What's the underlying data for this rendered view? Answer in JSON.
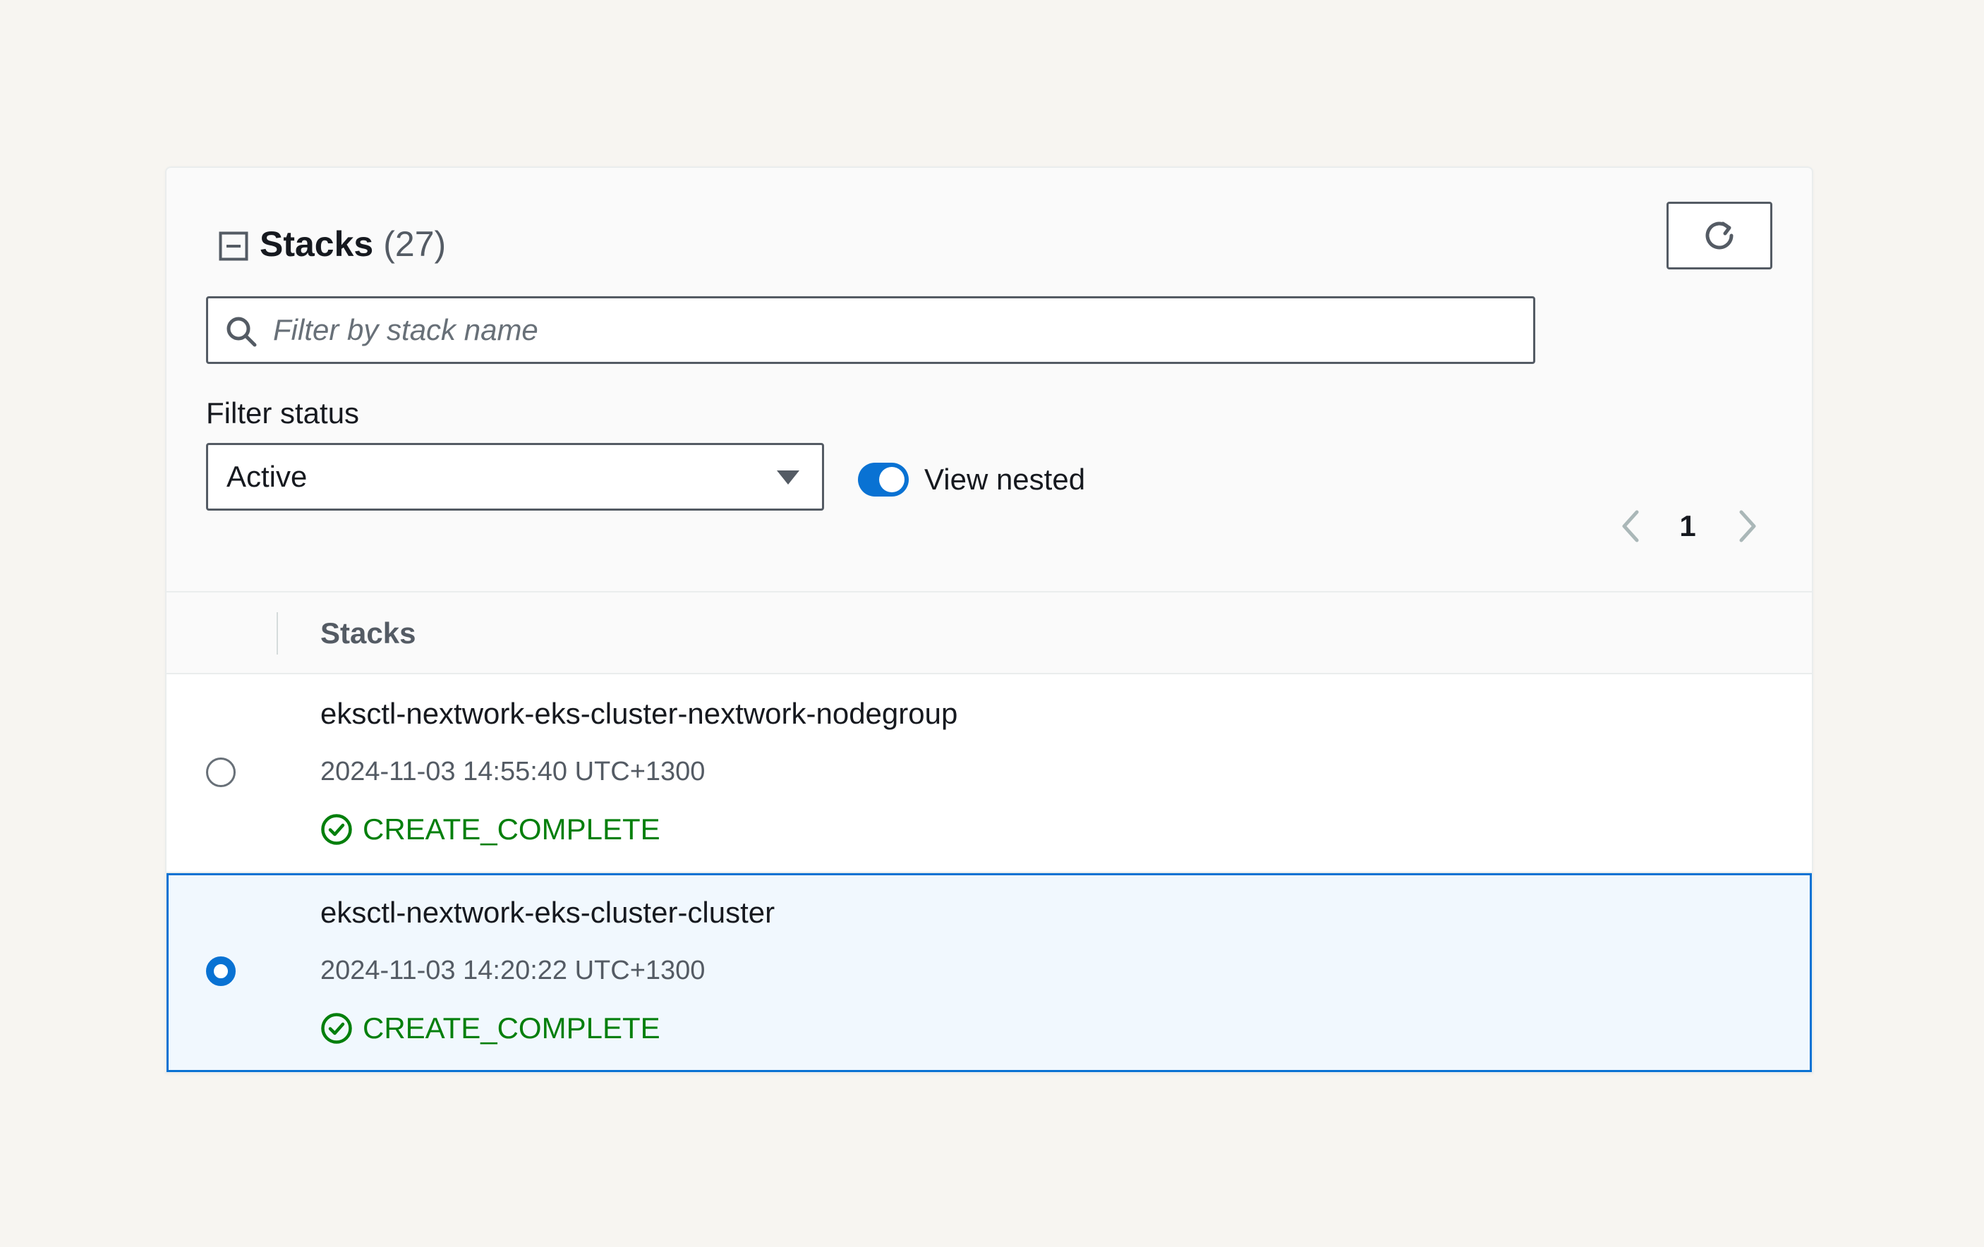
{
  "header": {
    "title": "Stacks",
    "count": "(27)"
  },
  "search": {
    "placeholder": "Filter by stack name",
    "value": ""
  },
  "filter_status": {
    "label": "Filter status",
    "selected": "Active"
  },
  "view_nested": {
    "label": "View nested",
    "enabled": true
  },
  "pagination": {
    "current_page": "1"
  },
  "table": {
    "column": "Stacks",
    "rows": [
      {
        "name": "eksctl-nextwork-eks-cluster-nextwork-nodegroup",
        "timestamp": "2024-11-03 14:55:40 UTC+1300",
        "status": "CREATE_COMPLETE",
        "selected": false
      },
      {
        "name": "eksctl-nextwork-eks-cluster-cluster",
        "timestamp": "2024-11-03 14:20:22 UTC+1300",
        "status": "CREATE_COMPLETE",
        "selected": true
      }
    ]
  },
  "colors": {
    "accent": "#0972d3",
    "success": "#037f0c",
    "selected_row_bg": "#f1f8fe",
    "page_bg": "#f7f5f1"
  },
  "icons": {
    "collapse": "collapse-icon",
    "refresh": "refresh-icon",
    "search": "search-icon",
    "caret": "caret-down-icon",
    "prev": "chevron-left-icon",
    "next": "chevron-right-icon",
    "status": "check-circle-icon"
  }
}
